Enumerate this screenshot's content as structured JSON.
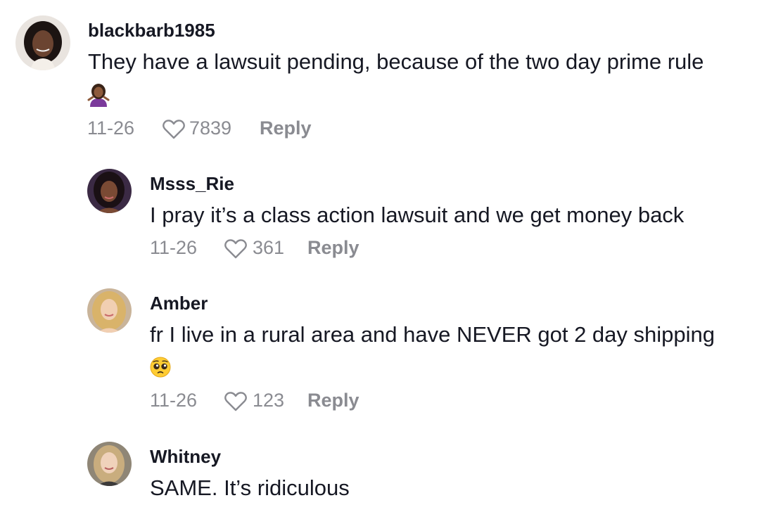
{
  "comments": [
    {
      "username": "blackbarb1985",
      "text": "They have a lawsuit pending, because of the two day prime rule",
      "emoji": "woman-shrugging-emoji",
      "date": "11-26",
      "likes": "7839",
      "reply_label": "Reply"
    },
    {
      "username": "Msss_Rie",
      "text": "I pray it’s a class action lawsuit and we get money back",
      "date": "11-26",
      "likes": "361",
      "reply_label": "Reply"
    },
    {
      "username": "Amber",
      "text": "fr I live in a rural area and have NEVER got 2 day shipping",
      "emoji": "pleading-face-emoji",
      "date": "11-26",
      "likes": "123",
      "reply_label": "Reply"
    },
    {
      "username": "Whitney",
      "text": "SAME. It’s ridiculous"
    }
  ],
  "icons": {
    "like": "heart-outline-icon"
  },
  "colors": {
    "text": "#161823",
    "meta": "#8a8b91"
  }
}
